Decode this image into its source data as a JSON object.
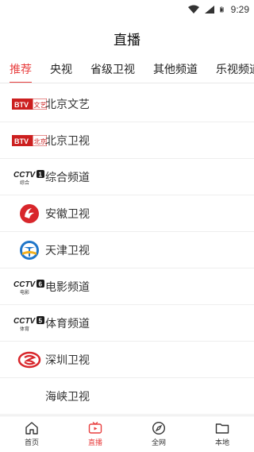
{
  "status_bar": {
    "time": "9:29"
  },
  "page_title": "直播",
  "tabs": [
    {
      "label": "推荐",
      "active": true
    },
    {
      "label": "央视",
      "active": false
    },
    {
      "label": "省级卫视",
      "active": false
    },
    {
      "label": "其他频道",
      "active": false
    },
    {
      "label": "乐视频道",
      "active": false
    }
  ],
  "channels": [
    {
      "name": "北京文艺",
      "logo": "btv-logo",
      "logo_text": "BTV",
      "logo_sub": "文艺"
    },
    {
      "name": "北京卫视",
      "logo": "btv-logo",
      "logo_text": "BTV",
      "logo_sub": "北京"
    },
    {
      "name": "综合频道",
      "logo": "cctv-logo",
      "logo_text": "CCTV",
      "logo_num": "1",
      "logo_sub": "综合"
    },
    {
      "name": "安徽卫视",
      "logo": "anhui-logo"
    },
    {
      "name": "天津卫视",
      "logo": "tianjin-logo"
    },
    {
      "name": "电影频道",
      "logo": "cctv-logo",
      "logo_text": "CCTV",
      "logo_num": "6",
      "logo_sub": "电影"
    },
    {
      "name": "体育频道",
      "logo": "cctv-logo",
      "logo_text": "CCTV",
      "logo_num": "5",
      "logo_sub": "体育"
    },
    {
      "name": "深圳卫视",
      "logo": "shenzhen-logo"
    },
    {
      "name": "海峡卫视",
      "logo": "none"
    }
  ],
  "bottom_nav": [
    {
      "label": "首页",
      "icon": "home-icon",
      "active": false
    },
    {
      "label": "直播",
      "icon": "tv-icon",
      "active": true
    },
    {
      "label": "全网",
      "icon": "compass-icon",
      "active": false
    },
    {
      "label": "本地",
      "icon": "folder-icon",
      "active": false
    }
  ],
  "colors": {
    "accent": "#e83f3f",
    "btv_red": "#cc1f1f",
    "text": "#333333"
  }
}
